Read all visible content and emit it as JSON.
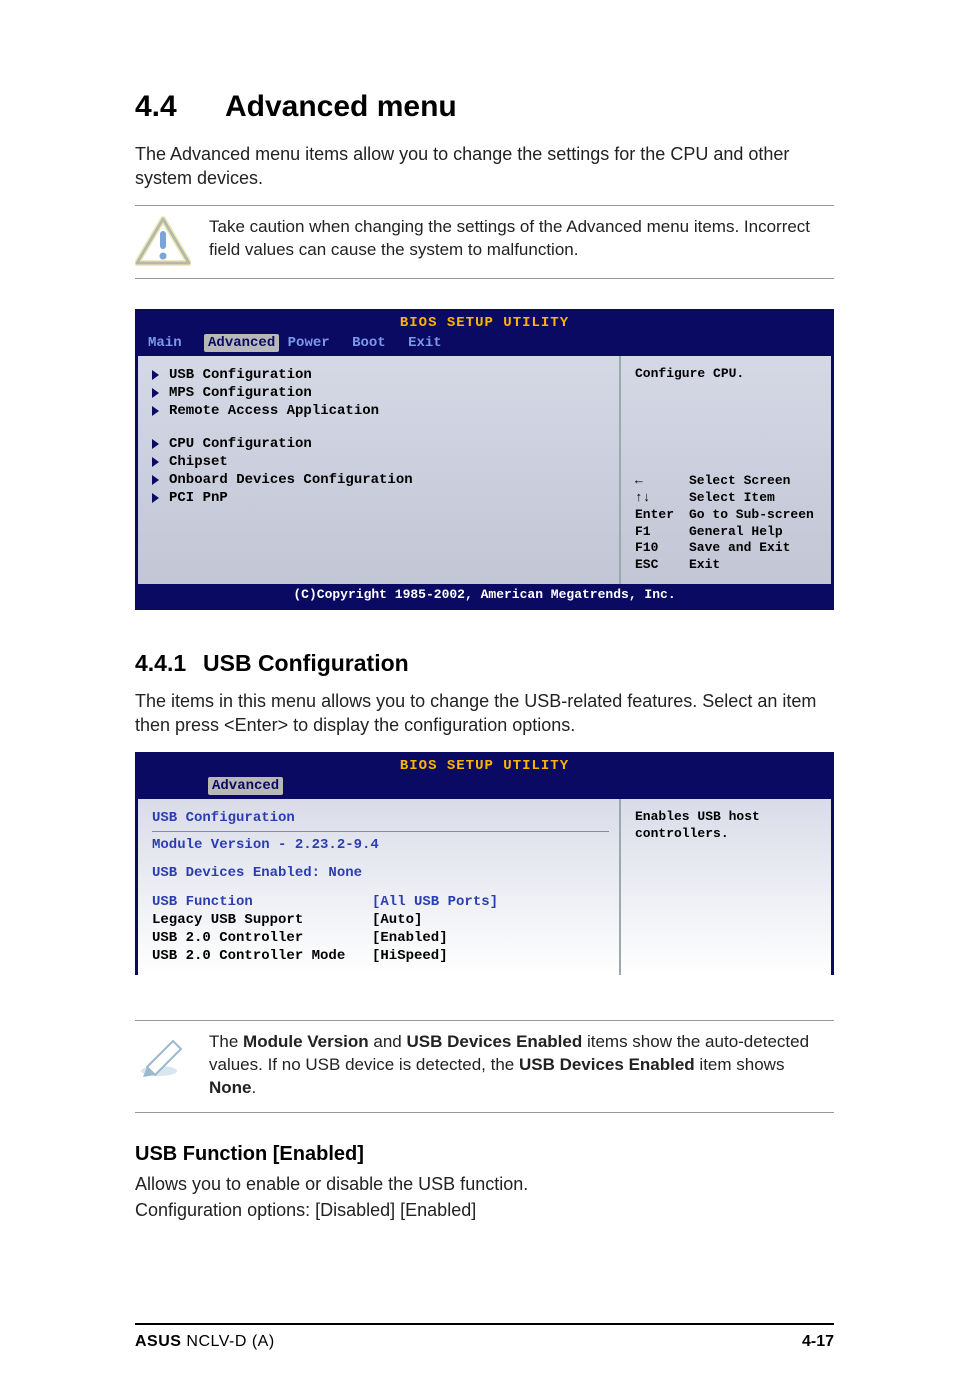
{
  "section": {
    "number": "4.4",
    "title": "Advanced menu"
  },
  "intro": "The Advanced menu items allow you to change the settings for the CPU and other system devices.",
  "caution": "Take caution when changing the settings of the Advanced menu items. Incorrect field values can cause the system to malfunction.",
  "bios1": {
    "utilTitle": "BIOS SETUP UTILITY",
    "tabs": [
      "Main",
      "Advanced",
      "Power",
      "Boot",
      "Exit"
    ],
    "activeTab": "Advanced",
    "menuItems1": [
      "USB Configuration",
      "MPS Configuration",
      "Remote Access Application"
    ],
    "menuItems2": [
      "CPU Configuration",
      "Chipset",
      "Onboard Devices Configuration",
      "PCI PnP"
    ],
    "helpTitle": "Configure CPU.",
    "keys": [
      {
        "key": "←",
        "desc": "Select Screen"
      },
      {
        "key": "↑↓",
        "desc": "Select Item"
      },
      {
        "key": "Enter",
        "desc": "Go to Sub-screen"
      },
      {
        "key": "F1",
        "desc": "General Help"
      },
      {
        "key": "F10",
        "desc": "Save and Exit"
      },
      {
        "key": "ESC",
        "desc": "Exit"
      }
    ],
    "copyright": "(C)Copyright 1985-2002, American Megatrends, Inc."
  },
  "subsection": {
    "number": "4.4.1",
    "title": "USB Configuration"
  },
  "subIntro": "The items in this menu allows you to change the USB-related features. Select an item then press <Enter> to display the configuration options.",
  "bios2": {
    "utilTitle": "BIOS SETUP UTILITY",
    "activeTab": "Advanced",
    "heading": "USB Configuration",
    "module": "Module Version - 2.23.2-9.4",
    "devices": "USB Devices Enabled: None",
    "rows": [
      {
        "label": "USB Function",
        "value": "[All USB Ports]"
      },
      {
        "label": "Legacy USB Support",
        "value": "[Auto]"
      },
      {
        "label": "USB 2.0 Controller",
        "value": "[Enabled]"
      },
      {
        "label": "USB 2.0 Controller Mode",
        "value": "[HiSpeed]"
      }
    ],
    "help1": "Enables USB host",
    "help2": "controllers."
  },
  "note": {
    "pre": "The ",
    "b1": "Module Version",
    "mid1": " and ",
    "b2": "USB Devices Enabled",
    "mid2": " items show the auto-detected values. If no USB device is detected, the ",
    "b3": "USB Devices Enabled",
    "mid3": " item shows ",
    "b4": "None",
    "post": "."
  },
  "item": {
    "title": "USB Function [Enabled]",
    "desc": "Allows you to enable or disable the USB function.",
    "opts": "Configuration options: [Disabled] [Enabled]"
  },
  "footer": {
    "product_b": "ASUS",
    "product_rest": " NCLV-D (A)",
    "page": "4-17"
  }
}
